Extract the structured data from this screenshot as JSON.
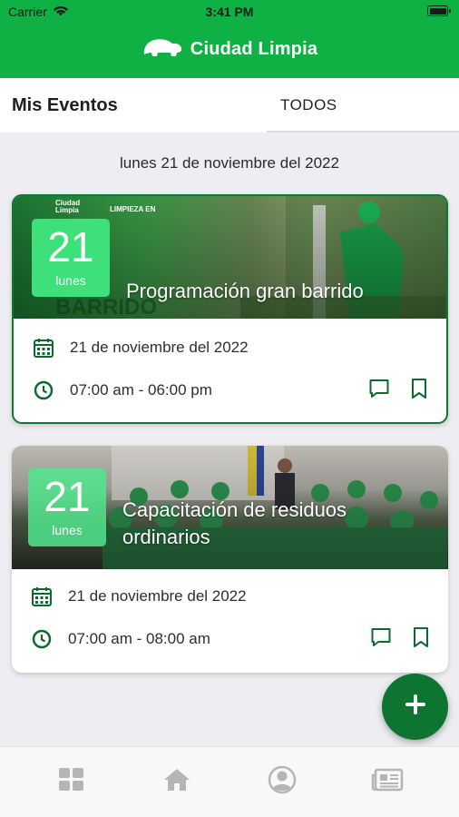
{
  "statusbar": {
    "carrier": "Carrier",
    "time": "3:41 PM"
  },
  "header": {
    "app_name": "Ciudad Limpia",
    "brand_color": "#0fb144"
  },
  "tabs": {
    "mine": "Mis Eventos",
    "all": "TODOS"
  },
  "date_heading": "lunes 21 de noviembre del 2022",
  "events": [
    {
      "day_number": "21",
      "day_name": "lunes",
      "title": "Programación gran barrido",
      "date": "21 de noviembre del 2022",
      "time": "07:00 am - 06:00 pm",
      "image_logo_text": "Ciudad Limpia",
      "image_banner_text": "LIMPIEZA EN",
      "image_overlay_text": "BARRIDO"
    },
    {
      "day_number": "21",
      "day_name": "lunes",
      "title": "Capacitación  de residuos ordinarios",
      "date": "21 de noviembre del 2022",
      "time": "07:00 am - 08:00 am"
    }
  ],
  "fab_icon": "plus-icon",
  "bottom_nav": [
    "grid-icon",
    "home-icon",
    "profile-icon",
    "news-icon"
  ],
  "colors": {
    "accent": "#0d7432",
    "icon_green": "#0b6a2c",
    "nav_icon": "#b5b5b5"
  }
}
